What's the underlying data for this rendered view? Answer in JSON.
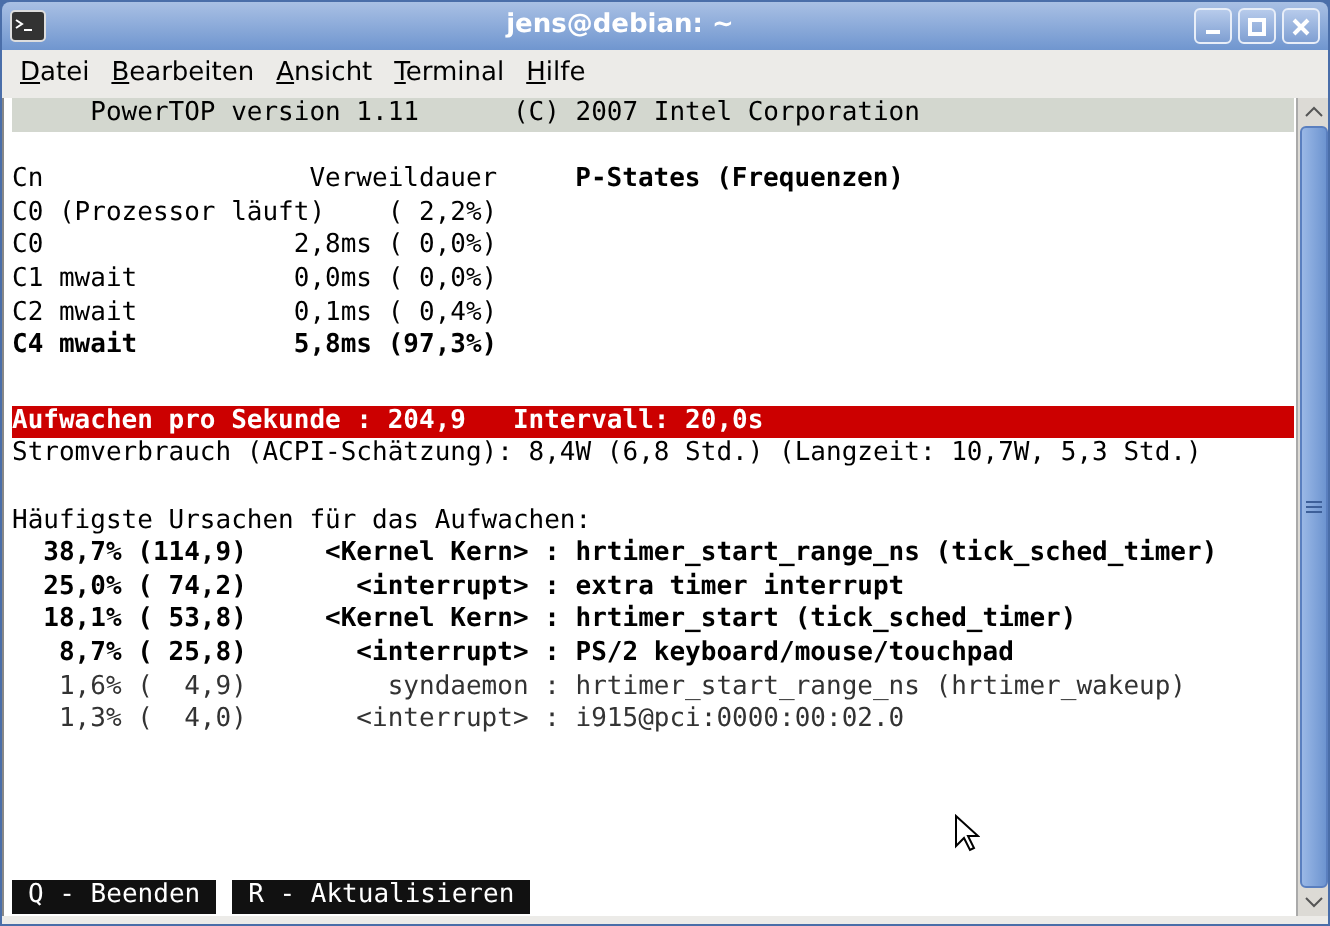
{
  "window": {
    "title": "jens@debian: ~"
  },
  "menu": [
    {
      "label": "Datei"
    },
    {
      "label": "Bearbeiten"
    },
    {
      "label": "Ansicht"
    },
    {
      "label": "Terminal"
    },
    {
      "label": "Hilfe"
    }
  ],
  "terminal": {
    "header_bar": "     PowerTOP version 1.11      (C) 2007 Intel Corporation",
    "cstates": {
      "columns": "Cn                 Verweildauer",
      "pstates_heading": "P-States (Frequenzen)",
      "rows": [
        {
          "text": "C0 (Prozessor läuft)    ( 2,2%)",
          "bold": false
        },
        {
          "text": "C0                2,8ms ( 0,0%)",
          "bold": false
        },
        {
          "text": "C1 mwait          0,0ms ( 0,0%)",
          "bold": false
        },
        {
          "text": "C2 mwait          0,1ms ( 0,4%)",
          "bold": false
        },
        {
          "text": "C4 mwait          5,8ms (97,3%)",
          "bold": true
        }
      ]
    },
    "wakeup_bar": "Aufwachen pro Sekunde : 204,9   Intervall: 20,0s",
    "power_line": "Stromverbrauch (ACPI-Schätzung): 8,4W (6,8 Std.) (Langzeit: 10,7W, 5,3 Std.)",
    "causes_heading": "Häufigste Ursachen für das Aufwachen:",
    "causes": [
      {
        "text": "  38,7% (114,9)     <Kernel Kern> : hrtimer_start_range_ns (tick_sched_timer)",
        "bold": true
      },
      {
        "text": "  25,0% ( 74,2)       <interrupt> : extra timer interrupt",
        "bold": true
      },
      {
        "text": "  18,1% ( 53,8)     <Kernel Kern> : hrtimer_start (tick_sched_timer)",
        "bold": true
      },
      {
        "text": "   8,7% ( 25,8)       <interrupt> : PS/2 keyboard/mouse/touchpad",
        "bold": true
      },
      {
        "text": "   1,6% (  4,9)         syndaemon : hrtimer_start_range_ns (hrtimer_wakeup)",
        "bold": false
      },
      {
        "text": "   1,3% (  4,0)       <interrupt> : i915@pci:0000:00:02.0",
        "bold": false
      }
    ],
    "keys": [
      "Q - Beenden",
      "R - Aktualisieren"
    ]
  }
}
